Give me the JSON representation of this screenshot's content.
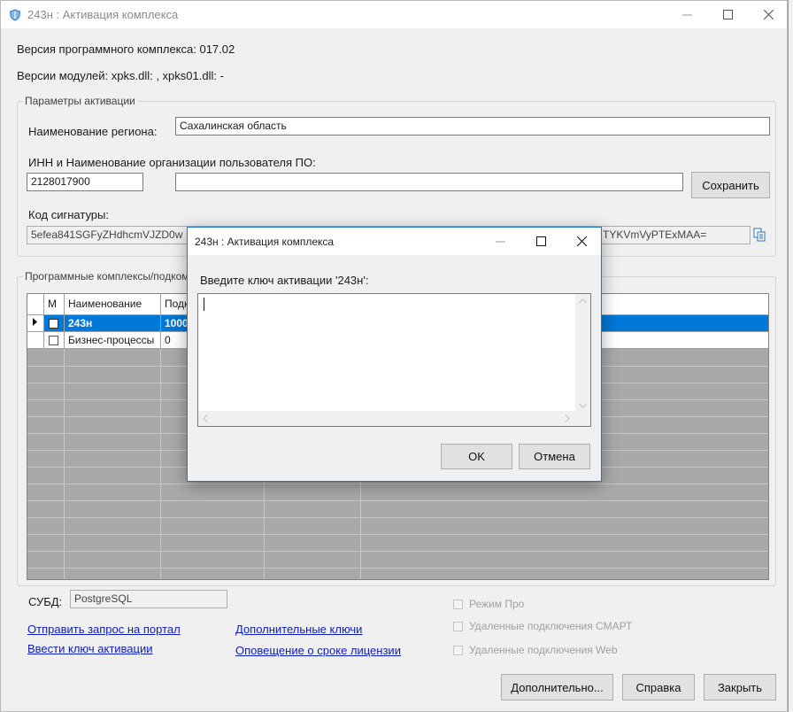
{
  "window": {
    "title": "243н : Активация комплекса"
  },
  "info": {
    "version_line": "Версия программного комплекса: 017.02",
    "modules_line": "Версии модулей: xpks.dll: , xpks01.dll: -"
  },
  "activation": {
    "legend": "Параметры активации",
    "region_label": "Наименование региона:",
    "region_value": "Сахалинская область",
    "org_label": "ИНН и Наименование организации пользователя ПО:",
    "inn_value": "2128017900",
    "org_name_value": "",
    "save_button": "Сохранить",
    "signature_label": "Код сигнатуры:",
    "signature_start": "5efea841SGFyZHdhcmVJZD0w",
    "signature_end": "TYKVmVyPTExMAA="
  },
  "complexes": {
    "legend": "Программные комплексы/подком",
    "headers": [
      "М",
      "Наименование",
      "Подк"
    ],
    "rows": [
      {
        "name": "243н",
        "value": "1000",
        "checked": false,
        "selected": true
      },
      {
        "name": "Бизнес-процессы",
        "value": "0",
        "checked": false,
        "selected": false
      }
    ]
  },
  "dbms": {
    "label": "СУБД:",
    "value": "PostgreSQL"
  },
  "links": {
    "send_request": "Отправить запрос на портал",
    "enter_key": "Ввести ключ активации",
    "additional_keys": "Дополнительные ключи",
    "license_notify": "Оповещение о сроке лицензии"
  },
  "options": {
    "pro_mode": "Режим Про",
    "remote_smart": "Удаленные подключения СМАРТ",
    "remote_web": "Удаленные подключения Web"
  },
  "footer": {
    "more_button": "Дополнительно...",
    "help_button": "Справка",
    "close_button": "Закрыть"
  },
  "dialog": {
    "title": "243н : Активация комплекса",
    "prompt": "Введите ключ активации '243н':",
    "key_value": "",
    "ok_button": "OK",
    "cancel_button": "Отмена"
  },
  "colors": {
    "selection": "#0078d7",
    "link": "#0b1db6",
    "dialog_border": "#1a78c8"
  }
}
